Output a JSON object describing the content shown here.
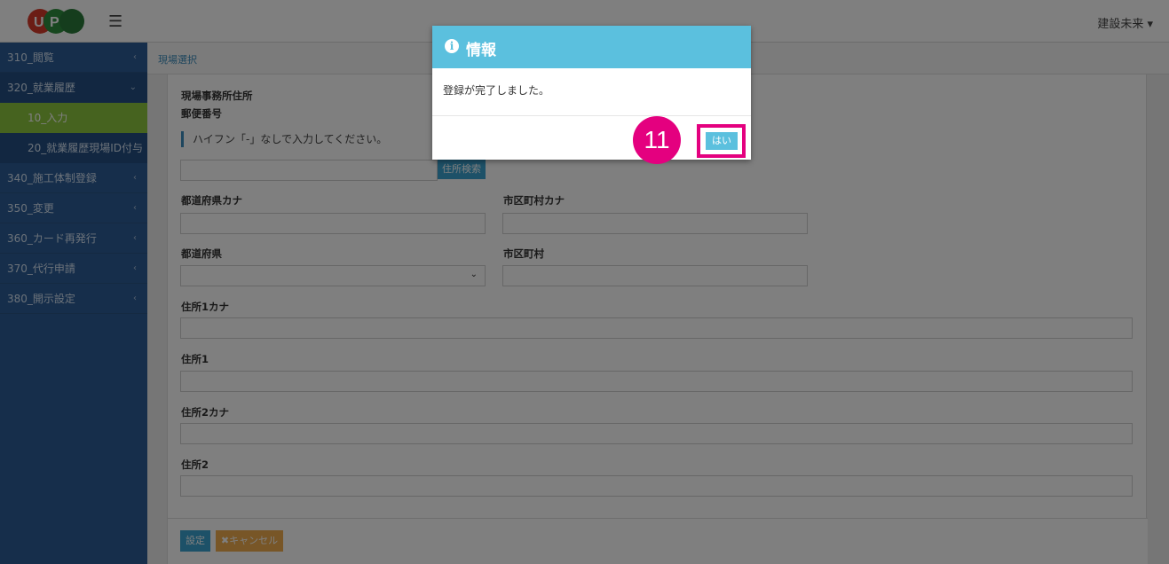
{
  "header": {
    "menu_icon": "hamburger-icon",
    "user_name": "建設未来 ▾"
  },
  "sidebar": {
    "items": [
      {
        "label": "310_閲覧",
        "caret": "‹"
      },
      {
        "label": "320_就業履歴",
        "caret": "⌄"
      },
      {
        "label": "10_入力"
      },
      {
        "label": "20_就業履歴現場ID付与"
      },
      {
        "label": "340_施工体制登録",
        "caret": "‹"
      },
      {
        "label": "350_変更",
        "caret": "‹"
      },
      {
        "label": "360_カード再発行",
        "caret": "‹"
      },
      {
        "label": "370_代行申請",
        "caret": "‹"
      },
      {
        "label": "380_開示設定",
        "caret": "‹"
      }
    ]
  },
  "breadcrumb": "現場選択",
  "form": {
    "section_title": "現場事務所住所",
    "postal_label": "郵便番号",
    "hint": "ハイフン「-」なしで入力してください。",
    "search_button": "住所検索",
    "pref_kana_label": "都道府県カナ",
    "city_kana_label": "市区町村カナ",
    "pref_label": "都道府県",
    "city_label": "市区町村",
    "addr1_kana_label": "住所1カナ",
    "addr1_label": "住所1",
    "addr2_kana_label": "住所2カナ",
    "addr2_label": "住所2",
    "set_button": "設定",
    "cancel_button": "✖キャンセル"
  },
  "modal": {
    "icon": "info-icon",
    "title": "情報",
    "message": "登録が完了しました。",
    "ok_button": "はい"
  },
  "annotation": {
    "step_number": "11",
    "color": "#e4007f"
  }
}
